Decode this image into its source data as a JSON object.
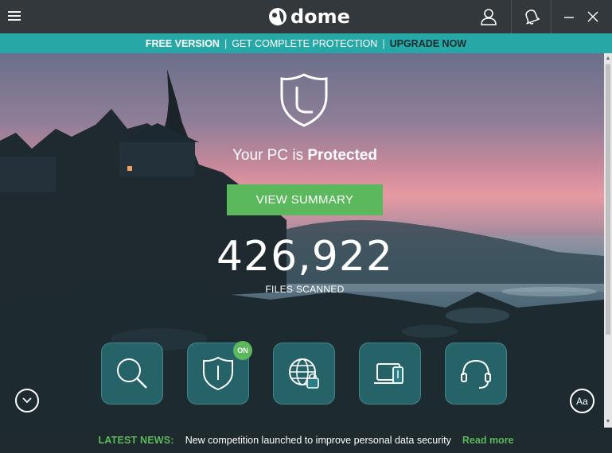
{
  "app": {
    "name": "dome"
  },
  "promo": {
    "free_version": "FREE VERSION",
    "separator": "|",
    "get_protection": "GET COMPLETE PROTECTION",
    "upgrade_now": "UPGRADE NOW"
  },
  "status": {
    "prefix": "Your PC is",
    "state": "Protected"
  },
  "view_summary": "VIEW SUMMARY",
  "files_scanned": {
    "count": "426,922",
    "label": "FILES SCANNED"
  },
  "tiles": [
    {
      "icon": "search-icon"
    },
    {
      "icon": "shield-icon",
      "badge": "ON"
    },
    {
      "icon": "globe-lock-icon"
    },
    {
      "icon": "laptop-phone-icon"
    },
    {
      "icon": "headset-icon"
    }
  ],
  "font_button": "Aa",
  "news": {
    "label": "LATEST NEWS:",
    "headline": "New competition launched to improve personal data security",
    "read_more": "Read more"
  },
  "colors": {
    "titlebar": "#33383c",
    "accent_teal": "#27a8a6",
    "green": "#5cb85c",
    "news_bg": "#1f2a2e"
  }
}
